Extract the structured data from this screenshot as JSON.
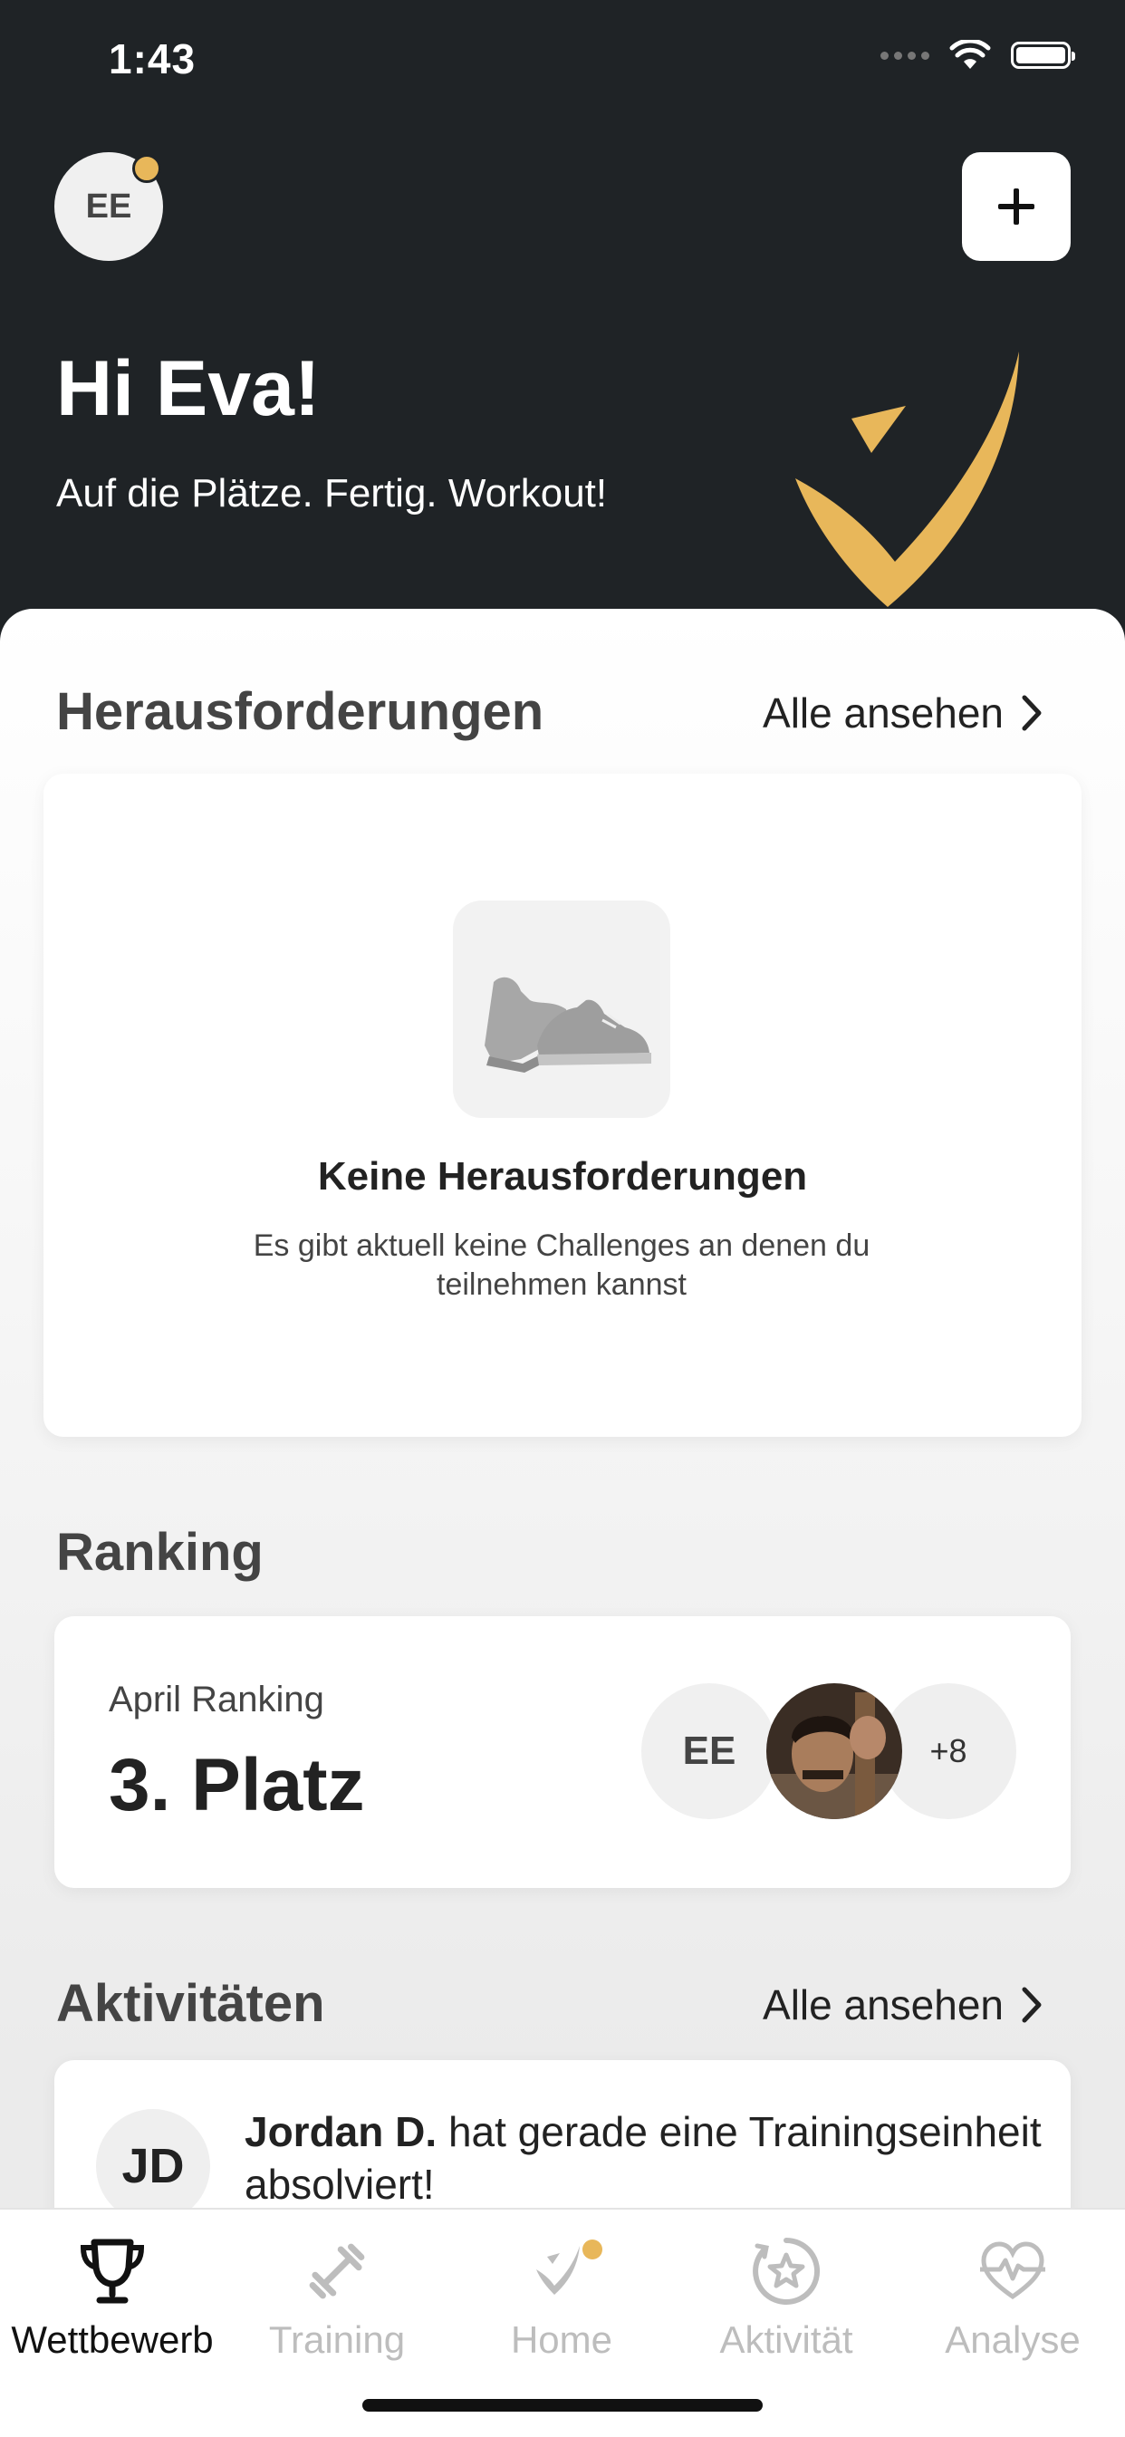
{
  "status_bar": {
    "time": "1:43"
  },
  "header": {
    "avatar_initials": "EE",
    "greeting": "Hi Eva!",
    "subtitle": "Auf die Plätze. Fertig. Workout!"
  },
  "challenges": {
    "title": "Herausforderungen",
    "see_all": "Alle ansehen",
    "empty_title": "Keine Herausforderungen",
    "empty_text": "Es gibt aktuell keine Challenges an denen du teilnehmen kannst"
  },
  "ranking": {
    "title": "Ranking",
    "label": "April Ranking",
    "value": "3. Platz",
    "avatars": [
      "EE",
      "",
      "+8"
    ]
  },
  "activities": {
    "title": "Aktivitäten",
    "see_all": "Alle ansehen",
    "items": [
      {
        "initials": "JD",
        "name": "Jordan D.",
        "text": "hat gerade eine Trainingseinheit absolviert!"
      }
    ]
  },
  "tabbar": {
    "tabs": [
      {
        "label": "Wettbewerb",
        "icon": "trophy-icon",
        "active": true
      },
      {
        "label": "Training",
        "icon": "dumbbell-icon",
        "active": false
      },
      {
        "label": "Home",
        "icon": "home-logo-icon",
        "active": false
      },
      {
        "label": "Aktivität",
        "icon": "star-badge-icon",
        "active": false
      },
      {
        "label": "Analyse",
        "icon": "heartbeat-icon",
        "active": false
      }
    ]
  },
  "colors": {
    "header_bg": "#1f2326",
    "accent": "#e8b75a",
    "tab_inactive": "#bdbdbd",
    "tab_active": "#111111"
  }
}
